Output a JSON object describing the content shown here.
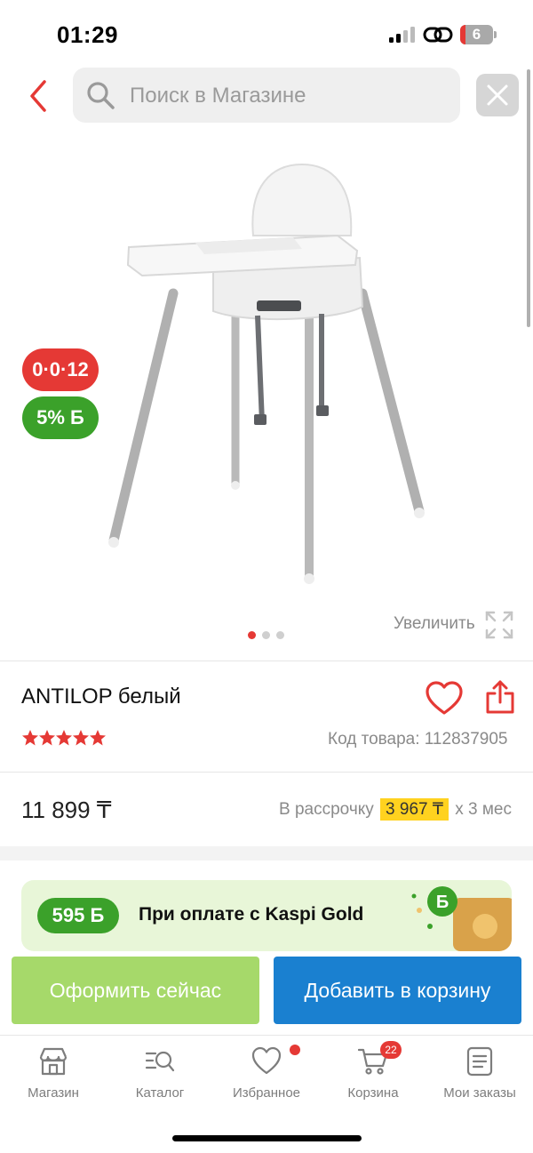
{
  "status_bar": {
    "time": "01:29",
    "battery": "6"
  },
  "header": {
    "search_placeholder": "Поиск в Магазине"
  },
  "gallery": {
    "badge_installment": "0·0·12",
    "badge_bonus": "5% Б",
    "zoom_label": "Увеличить",
    "slides": 3,
    "active_slide": 1
  },
  "product": {
    "title": "ANTILOP белый",
    "rating_stars": 5,
    "sku": "Код товара: 112837905",
    "price": "11 899 ₸",
    "installment_prefix": "В рассрочку",
    "installment_monthly": "3 967 ₸",
    "installment_suffix": "x 3 мес"
  },
  "promo": {
    "bonus": "595 Б",
    "text": "При оплате с Kaspi Gold"
  },
  "actions": {
    "buy_now": "Оформить сейчас",
    "add_to_cart": "Добавить в корзину"
  },
  "nav": {
    "items": [
      {
        "label": "Магазин",
        "icon": "store-icon"
      },
      {
        "label": "Каталог",
        "icon": "catalog-search-icon"
      },
      {
        "label": "Избранное",
        "icon": "heart-icon"
      },
      {
        "label": "Корзина",
        "icon": "cart-icon",
        "count": "22"
      },
      {
        "label": "Мои заказы",
        "icon": "orders-icon"
      }
    ]
  },
  "colors": {
    "accent_red": "#e53935",
    "kaspi_green": "#3ba12a",
    "cart_blue": "#1a80d0",
    "buy_green": "#a6d96a",
    "highlight_yellow": "#ffd21f"
  }
}
